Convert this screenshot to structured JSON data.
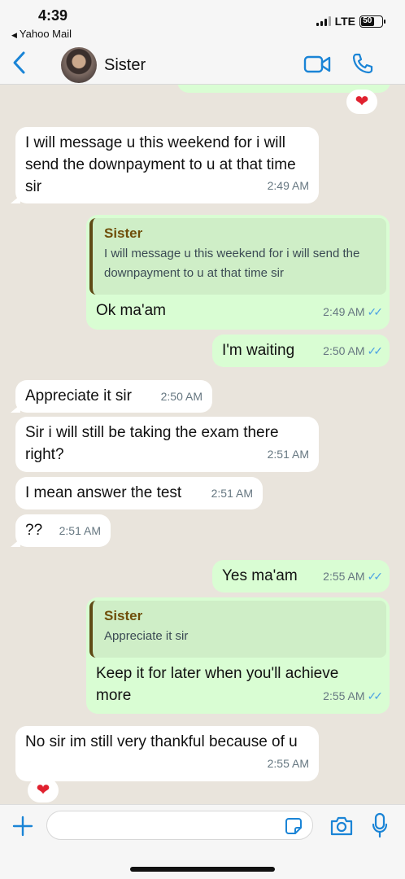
{
  "status_bar": {
    "time": "4:39",
    "back_app": "Yahoo Mail",
    "network": "LTE",
    "battery": "50"
  },
  "header": {
    "contact_name": "Sister"
  },
  "messages": [
    {
      "text": "I will message u this weekend for i will send the downpayment to u at that time sir",
      "time": "2:49 AM"
    },
    {
      "quote_name": "Sister",
      "quote_text": "I will message u this weekend for i will send the downpayment to u at that time sir",
      "text": "Ok ma'am",
      "time": "2:49 AM"
    },
    {
      "text": "I'm waiting",
      "time": "2:50 AM"
    },
    {
      "text": "Appreciate it sir",
      "time": "2:50 AM"
    },
    {
      "text": "Sir i will still be taking the exam there right?",
      "time": "2:51 AM"
    },
    {
      "text": "I mean answer the test",
      "time": "2:51 AM"
    },
    {
      "text": "??",
      "time": "2:51 AM"
    },
    {
      "text": "Yes ma'am",
      "time": "2:55 AM"
    },
    {
      "quote_name": "Sister",
      "quote_text": "Appreciate it sir",
      "text": "Keep it for later when you'll achieve more",
      "time": "2:55 AM"
    },
    {
      "text": "No sir im still very thankful because of u",
      "time": "2:55 AM"
    }
  ],
  "reactions": {
    "heart": "❤"
  },
  "colors": {
    "accent": "#1a84d6",
    "outgoing": "#d9fdd3",
    "incoming": "#ffffff",
    "read_ticks": "#4fa3e3",
    "quote_name": "#6f4e0a"
  },
  "icons": [
    "chevron-left-icon",
    "video-call-icon",
    "phone-icon",
    "plus-icon",
    "sticker-icon",
    "camera-icon",
    "microphone-icon"
  ]
}
